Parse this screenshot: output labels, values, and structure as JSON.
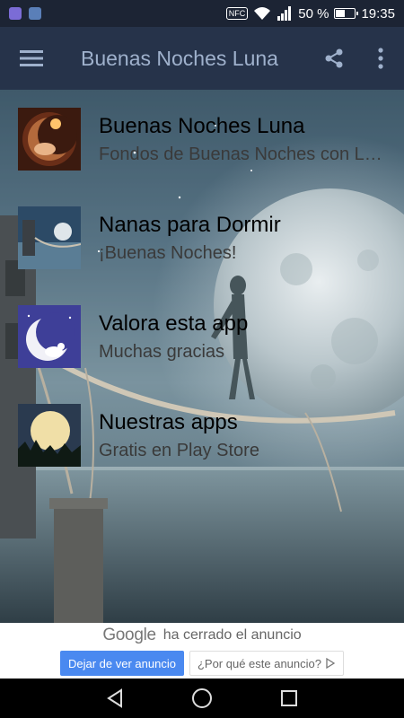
{
  "status_bar": {
    "left_icons": [
      "gallery-icon",
      "app-icon"
    ],
    "nfc": "NFC",
    "battery_percent": "50 %",
    "battery_level": 0.5,
    "time": "19:35"
  },
  "toolbar": {
    "title": "Buenas Noches Luna",
    "icons": [
      "menu-icon",
      "share-icon",
      "more-vert-icon"
    ]
  },
  "list": [
    {
      "title": "Buenas Noches Luna",
      "subtitle": "Fondos de Buenas Noches con Luna",
      "icon": "moon-baby-thumbnail"
    },
    {
      "title": "Nanas para Dormir",
      "subtitle": "¡Buenas Noches!",
      "icon": "night-sea-thumbnail"
    },
    {
      "title": "Valora esta app",
      "subtitle": "Muchas gracias",
      "icon": "crescent-bunny-thumbnail"
    },
    {
      "title": "Nuestras apps",
      "subtitle": "Gratis en Play Store",
      "icon": "full-moon-trees-thumbnail"
    }
  ],
  "ad": {
    "brand": "Google",
    "closed_text": "ha cerrado el anuncio",
    "stop_button": "Dejar de ver anuncio",
    "why_button": "¿Por qué este anuncio?"
  },
  "colors": {
    "toolbar": "#26334a",
    "title": "#9fb1cc",
    "ad_button": "#4a89f0"
  }
}
